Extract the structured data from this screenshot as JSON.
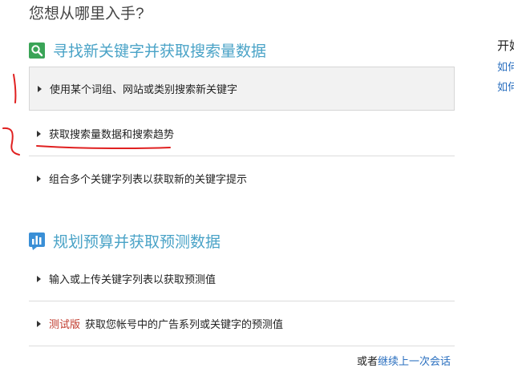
{
  "page_heading": "您想从哪里入手?",
  "sections": [
    {
      "title": "寻找新关键字并获取搜索量数据",
      "icon": "search-icon",
      "options": [
        "使用某个词组、网站或类别搜索新关键字",
        "获取搜索量数据和搜索趋势",
        "组合多个关键字列表以获取新的关键字提示"
      ]
    },
    {
      "title": "规划预算并获取预测数据",
      "icon": "bar-chart-icon",
      "options": [
        "输入或上传关键字列表以获取预测值",
        "获取您帐号中的广告系列或关键字的预测值"
      ],
      "beta_label": "测试版"
    }
  ],
  "footer": {
    "prefix": "或者",
    "link": "继续上一次会话"
  },
  "side_panel": {
    "title": "开始",
    "link1": "如何",
    "link2": "如何"
  },
  "colors": {
    "accent": "#4aa3c7",
    "link": "#2a6fbf",
    "beta": "#c0392b",
    "annotation": "#e02020"
  }
}
